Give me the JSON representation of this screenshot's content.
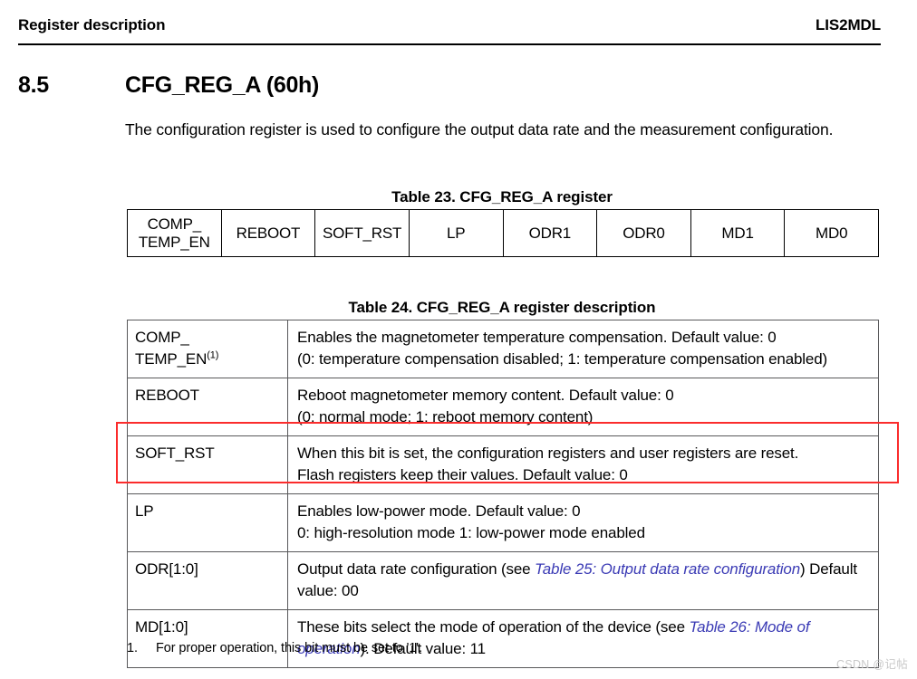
{
  "header": {
    "left_title": "Register description",
    "right_title": "LIS2MDL"
  },
  "section": {
    "number": "8.5",
    "title": "CFG_REG_A (60h)",
    "intro": "The configuration register is used to configure the output data rate and the measurement configuration."
  },
  "table23": {
    "caption": "Table 23. CFG_REG_A register",
    "bits": [
      {
        "line1": "COMP_",
        "line2": "TEMP_EN"
      },
      {
        "line1": "REBOOT",
        "line2": ""
      },
      {
        "line1": "SOFT_RST",
        "line2": ""
      },
      {
        "line1": "LP",
        "line2": ""
      },
      {
        "line1": "ODR1",
        "line2": ""
      },
      {
        "line1": "ODR0",
        "line2": ""
      },
      {
        "line1": "MD1",
        "line2": ""
      },
      {
        "line1": "MD0",
        "line2": ""
      }
    ]
  },
  "table24": {
    "caption": "Table 24. CFG_REG_A register description",
    "rows": [
      {
        "name_line1": "COMP_",
        "name_line2": "TEMP_EN",
        "name_sup": "(1)",
        "desc_line1": "Enables the magnetometer temperature compensation. Default value: 0",
        "desc_line2_pre": "(0: temperature compensation disabled; 1: temperature compensation enabled)",
        "desc_link": "",
        "desc_line2_post": ""
      },
      {
        "name_line1": "REBOOT",
        "name_line2": "",
        "name_sup": "",
        "desc_line1": "Reboot magnetometer memory content. Default value: 0",
        "desc_line2_pre": "(0: normal mode; 1: reboot memory content)",
        "desc_link": "",
        "desc_line2_post": ""
      },
      {
        "name_line1": "SOFT_RST",
        "name_line2": "",
        "name_sup": "",
        "desc_line1": "When this bit is set, the configuration registers and user registers are reset.",
        "desc_line2_pre": "Flash registers keep their values. Default value: 0",
        "desc_link": "",
        "desc_line2_post": ""
      },
      {
        "name_line1": "LP",
        "name_line2": "",
        "name_sup": "",
        "desc_line1": "Enables low-power mode. Default value: 0",
        "desc_line2_pre": "0: high-resolution mode 1: low-power mode enabled",
        "desc_link": "",
        "desc_line2_post": ""
      },
      {
        "name_line1": "ODR[1:0]",
        "name_line2": "",
        "name_sup": "",
        "desc_line1": "",
        "desc_line2_pre": "Output data rate configuration (see ",
        "desc_link": "Table 25: Output data rate configuration",
        "desc_line2_post": ") Default value: 00"
      },
      {
        "name_line1": "MD[1:0]",
        "name_line2": "",
        "name_sup": "",
        "desc_line1": "",
        "desc_line2_pre": "These bits select the mode of operation of the device (see ",
        "desc_link": "Table 26: Mode of operation",
        "desc_line2_post": "). Default value: 11"
      }
    ]
  },
  "footnote": {
    "number": "1.",
    "text": "For proper operation, this bit must be set to '1'."
  },
  "watermark": {
    "text": "CSDN @记帖"
  },
  "colors": {
    "link": "#3b3bb5",
    "highlight_box": "#fb2c2c",
    "table_border": "#58585a"
  }
}
